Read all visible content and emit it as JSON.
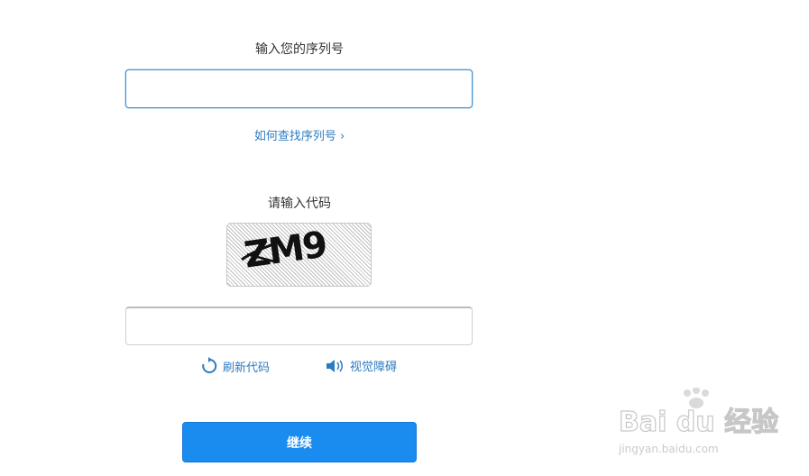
{
  "serial": {
    "label": "输入您的序列号",
    "value": "",
    "placeholder": "",
    "help_link": "如何查找序列号 ›"
  },
  "captcha": {
    "label": "请输入代码",
    "image_text": "ZM9",
    "value": "",
    "refresh_label": "刷新代码",
    "audio_label": "视觉障碍"
  },
  "actions": {
    "continue_label": "继续"
  },
  "watermark": {
    "brand": "Bai du 经验",
    "url": "jingyan.baidu.com"
  },
  "colors": {
    "accent": "#1a8cf0",
    "link": "#2c7bc2"
  }
}
